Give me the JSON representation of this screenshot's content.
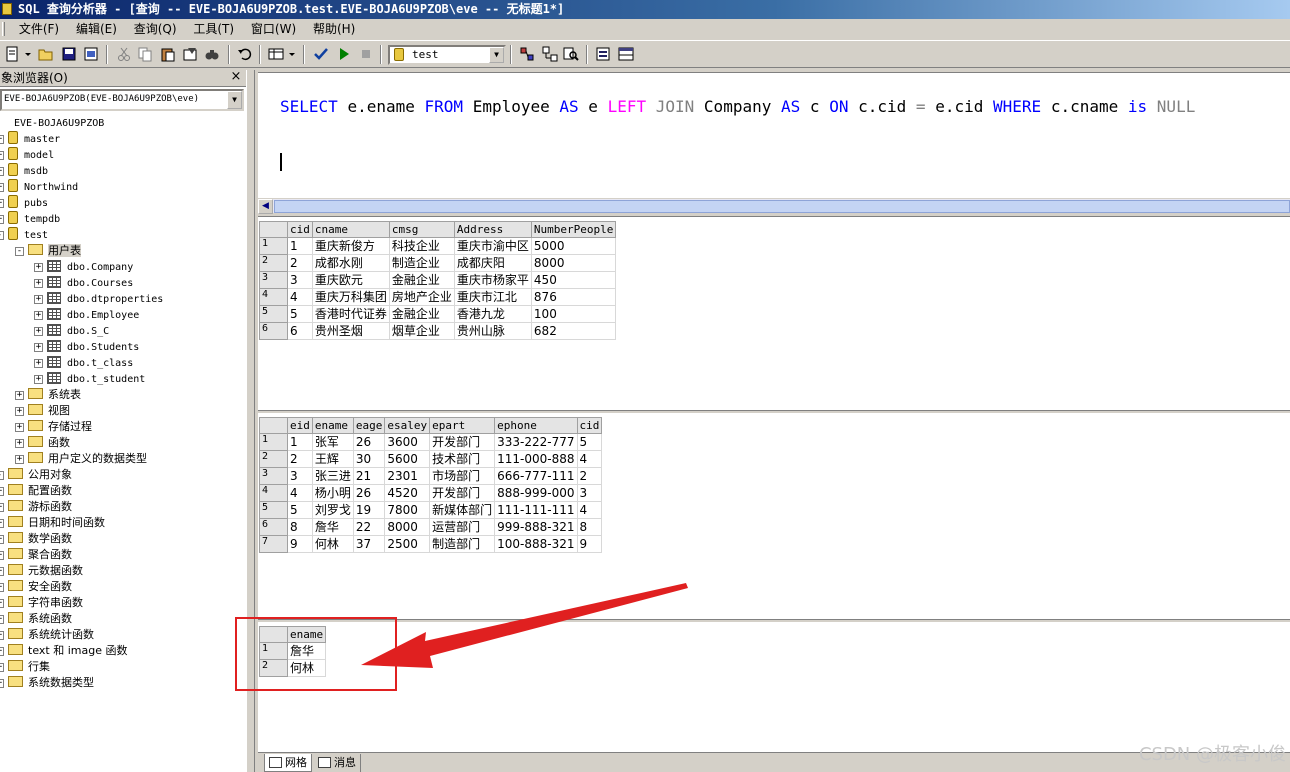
{
  "window": {
    "title": "SQL 查询分析器 - [查询 -- EVE-BOJA6U9PZOB.test.EVE-BOJA6U9PZOB\\eve -- 无标题1*]"
  },
  "menu": {
    "items": [
      "文件(F)",
      "编辑(E)",
      "查询(Q)",
      "工具(T)",
      "窗口(W)",
      "帮助(H)"
    ]
  },
  "toolbar": {
    "database": "test"
  },
  "object_browser": {
    "title": "象浏览器(O)",
    "close": "×",
    "server_selector": "EVE-BOJA6U9PZOB(EVE-BOJA6U9PZOB\\eve)",
    "server_node": "EVE-BOJA6U9PZOB",
    "databases": [
      "master",
      "model",
      "msdb",
      "Northwind",
      "pubs",
      "tempdb",
      "test"
    ],
    "user_tables_folder": "用户表",
    "tables": [
      "dbo.Company",
      "dbo.Courses",
      "dbo.dtproperties",
      "dbo.Employee",
      "dbo.S_C",
      "dbo.Students",
      "dbo.t_class",
      "dbo.t_student"
    ],
    "test_folders": [
      "系统表",
      "视图",
      "存储过程",
      "函数",
      "用户定义的数据类型"
    ],
    "common_objects": "公用对象",
    "common_folders": [
      "配置函数",
      "游标函数",
      "日期和时间函数",
      "数学函数",
      "聚合函数",
      "元数据函数",
      "安全函数",
      "字符串函数",
      "系统函数",
      "系统统计函数",
      "text 和 image 函数",
      "行集",
      "系统数据类型"
    ]
  },
  "editor": {
    "sql_tokens": {
      "select": "SELECT",
      "col": "e.ename",
      "from": "FROM",
      "t1": "Employee",
      "as1": "AS",
      "a1": "e",
      "left": "LEFT",
      "join": "JOIN",
      "t2": "Company",
      "as2": "AS",
      "a2": "c",
      "on": "ON",
      "c1": "c.cid",
      "eq": "=",
      "c2": "e.cid",
      "where": "WHERE",
      "c3": "c.cname",
      "is": "is",
      "null": "NULL"
    }
  },
  "results": {
    "company": {
      "columns": [
        "cid",
        "cname",
        "cmsg",
        "Address",
        "NumberPeople"
      ],
      "rows": [
        [
          "1",
          "1",
          "重庆新俊方",
          "科技企业",
          "重庆市渝中区",
          "5000"
        ],
        [
          "2",
          "2",
          "成都水刚",
          "制造企业",
          "成都庆阳",
          "8000"
        ],
        [
          "3",
          "3",
          "重庆欧元",
          "金融企业",
          "重庆市杨家平",
          "450"
        ],
        [
          "4",
          "4",
          "重庆万科集团",
          "房地产企业",
          "重庆市江北",
          "876"
        ],
        [
          "5",
          "5",
          "香港时代证券",
          "金融企业",
          "香港九龙",
          "100"
        ],
        [
          "6",
          "6",
          "贵州圣烟",
          "烟草企业",
          "贵州山脉",
          "682"
        ]
      ]
    },
    "employee": {
      "columns": [
        "eid",
        "ename",
        "eage",
        "esaley",
        "epart",
        "ephone",
        "cid"
      ],
      "rows": [
        [
          "1",
          "1",
          "张军",
          "26",
          "3600",
          "开发部门",
          "333-222-777",
          "5"
        ],
        [
          "2",
          "2",
          "王辉",
          "30",
          "5600",
          "技术部门",
          "111-000-888",
          "4"
        ],
        [
          "3",
          "3",
          "张三进",
          "21",
          "2301",
          "市场部门",
          "666-777-111",
          "2"
        ],
        [
          "4",
          "4",
          "杨小明",
          "26",
          "4520",
          "开发部门",
          "888-999-000",
          "3"
        ],
        [
          "5",
          "5",
          "刘罗戈",
          "19",
          "7800",
          "新媒体部门",
          "111-111-111",
          "4"
        ],
        [
          "6",
          "8",
          "詹华",
          "22",
          "8000",
          "运营部门",
          "999-888-321",
          "8"
        ],
        [
          "7",
          "9",
          "何林",
          "37",
          "2500",
          "制造部门",
          "100-888-321",
          "9"
        ]
      ]
    },
    "query_result": {
      "columns": [
        "ename"
      ],
      "rows": [
        [
          "1",
          "詹华"
        ],
        [
          "2",
          "何林"
        ]
      ]
    }
  },
  "result_tabs": {
    "grid": "网格",
    "messages": "消息"
  },
  "watermark": "CSDN @极客小俊",
  "colors": {
    "keyword": "#0000ff",
    "join_keyword": "#ff00ff",
    "null_keyword": "#808080",
    "annotation": "#e02020"
  }
}
